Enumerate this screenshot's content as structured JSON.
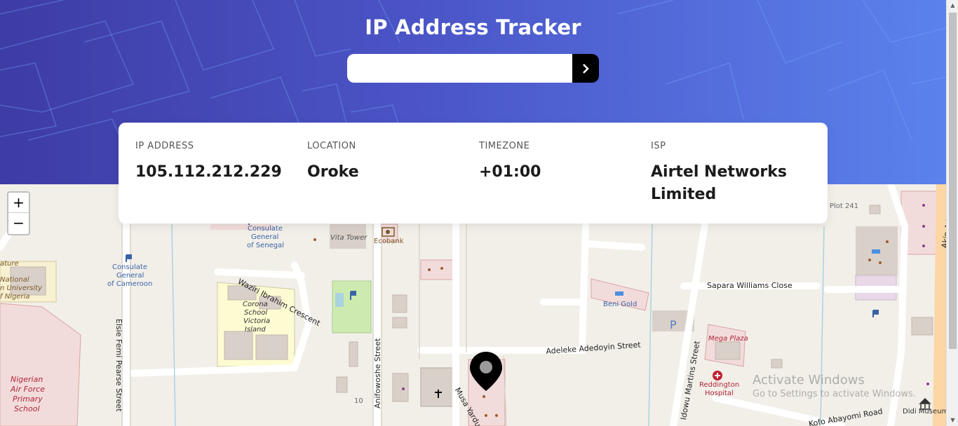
{
  "header": {
    "title": "IP Address Tracker",
    "search": {
      "placeholder": "",
      "value": "",
      "button_icon": "chevron-right-icon"
    }
  },
  "info_card": {
    "items": [
      {
        "label": "IP ADDRESS",
        "value": "105.112.212.229"
      },
      {
        "label": "LOCATION",
        "value": "Oroke"
      },
      {
        "label": "TIMEZONE",
        "value": "+01:00"
      },
      {
        "label": "ISP",
        "value": "Airtel Networks Limited"
      }
    ]
  },
  "map": {
    "zoom_in": "+",
    "zoom_out": "−",
    "labels": {
      "consulate_senegal": "Consulate General of Senegal",
      "consulate_senegal_1": "Consulate",
      "consulate_senegal_2": "General",
      "consulate_senegal_3": "of Senegal",
      "vita_tower": "Vita Tower",
      "ecobank": "Ecobank",
      "consulate_cameroon_1": "Consulate",
      "consulate_cameroon_2": "General",
      "consulate_cameroon_3": "of Cameroon",
      "waziri": "Waziri Ibrahim Crescent",
      "corona_1": "Corona",
      "corona_2": "School",
      "corona_3": "Victoria",
      "corona_4": "Island",
      "national_1": "ature",
      "national_2": "National",
      "national_3": "n University",
      "national_4": "f Nigeria",
      "naf_1": "Nigerian",
      "naf_2": "Air Force",
      "naf_3": "Primary",
      "naf_4": "School",
      "elsie": "Elsie Femi Pearse Street",
      "anifowoshe": "Anifowoshe Street",
      "musa": "Musa Yardua S",
      "adeleke": "Adeleke Adedoyin Street",
      "beni_gold": "Beni Gold",
      "sapara": "Sapara Williams Close",
      "mega_plaza": "Mega Plaza",
      "reddington_1": "Reddington",
      "reddington_2": "Hospital",
      "idowu": "Idowu Martins Street",
      "kofo": "Kofo Abayomi Road",
      "didi": "Didi Museum",
      "plot": "Plot 241",
      "akin": "Akin Ad",
      "num_10": "10"
    }
  },
  "watermark": {
    "line1": "Activate Windows",
    "line2": "Go to Settings to activate Windows."
  },
  "colors": {
    "header_start": "#3e3ca5",
    "header_end": "#5b82ec",
    "marker": "#000000"
  }
}
